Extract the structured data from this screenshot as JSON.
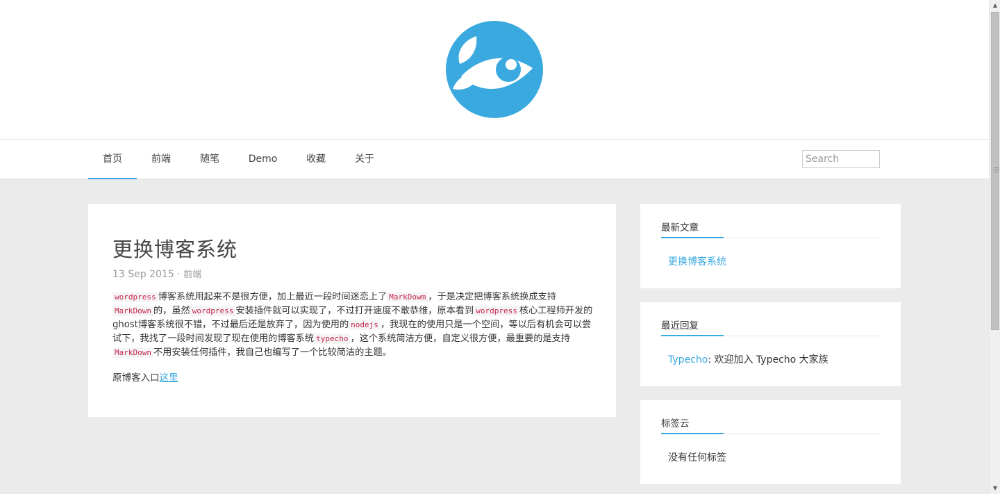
{
  "header": {
    "logo_icon": "fish-eye-logo-icon",
    "brand_color": "#3aa9e0"
  },
  "nav": {
    "items": [
      {
        "label": "首页"
      },
      {
        "label": "前端"
      },
      {
        "label": "随笔"
      },
      {
        "label": "Demo"
      },
      {
        "label": "收藏"
      },
      {
        "label": "关于"
      }
    ],
    "active_index": 0,
    "search_placeholder": "Search"
  },
  "post": {
    "title": "更换博客系统",
    "date": "13 Sep 2015",
    "separator": " · ",
    "category": "前端",
    "body": [
      {
        "t": "code",
        "v": "wordpress"
      },
      {
        "t": "text",
        "v": "博客系统用起来不是很方便，加上最近一段时间迷恋上了"
      },
      {
        "t": "code",
        "v": "MarkDowm"
      },
      {
        "t": "text",
        "v": "，于是决定把博客系统换成支持"
      },
      {
        "t": "code",
        "v": "MarkDown"
      },
      {
        "t": "text",
        "v": "的，虽然"
      },
      {
        "t": "code",
        "v": "wordpress"
      },
      {
        "t": "text",
        "v": "安装插件就可以实现了，不过打开速度不敢恭维，原本看到"
      },
      {
        "t": "code",
        "v": "wordpress"
      },
      {
        "t": "text",
        "v": "核心工程师开发的ghost博客系统很不错，不过最后还是放弃了，因为使用的"
      },
      {
        "t": "code",
        "v": "nodejs"
      },
      {
        "t": "text",
        "v": "，我现在的使用只是一个空间，等以后有机会可以尝试下，我找了一段时间发现了现在使用的博客系统"
      },
      {
        "t": "code",
        "v": "typecho"
      },
      {
        "t": "text",
        "v": "，这个系统简洁方便，自定义很方便，最重要的是支持"
      },
      {
        "t": "code",
        "v": "MarkDown"
      },
      {
        "t": "text",
        "v": "不用安装任何插件，我自己也编写了一个比较简洁的主题。"
      }
    ],
    "link_prefix": "原博客入口",
    "link_text": "这里"
  },
  "sidebar": {
    "recent_posts": {
      "title": "最新文章",
      "items": [
        "更换博客系统"
      ]
    },
    "recent_comments": {
      "title": "最近回复",
      "author": "Typecho",
      "text": ": 欢迎加入 Typecho 大家族"
    },
    "tags": {
      "title": "标签云",
      "empty_text": "没有任何标签"
    }
  }
}
